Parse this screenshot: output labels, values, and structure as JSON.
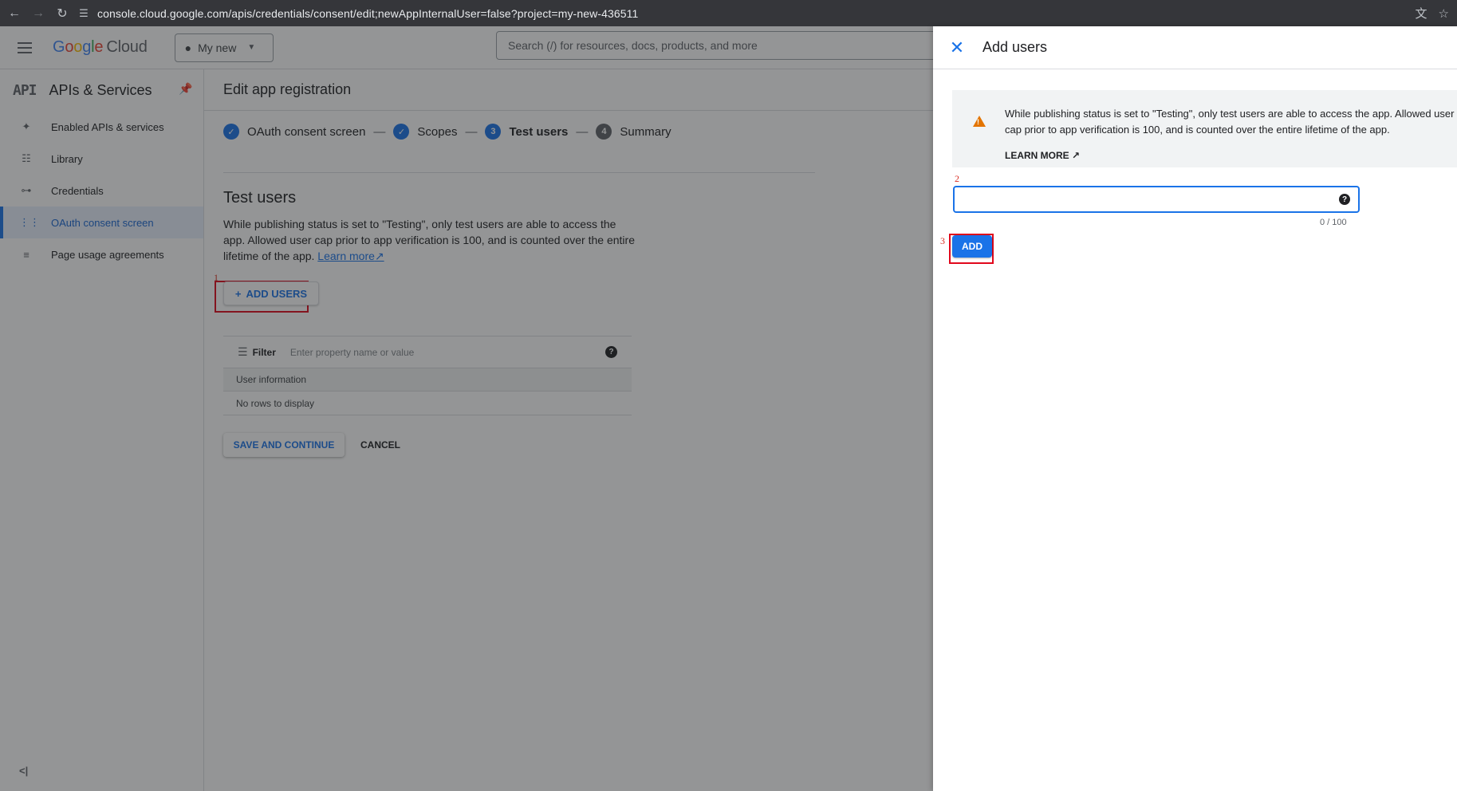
{
  "browser": {
    "url": "console.cloud.google.com/apis/credentials/consent/edit;newAppInternalUser=false?project=my-new-436511"
  },
  "topbar": {
    "logo_google": [
      "G",
      "o",
      "o",
      "g",
      "l",
      "e"
    ],
    "logo_cloud": "Cloud",
    "project_label": "My new",
    "search_placeholder": "Search (/) for resources, docs, products, and more"
  },
  "sidebar": {
    "api_badge": "API",
    "title": "APIs & Services",
    "items": [
      {
        "label": "Enabled APIs & services",
        "icon": "api-hub-icon"
      },
      {
        "label": "Library",
        "icon": "library-icon"
      },
      {
        "label": "Credentials",
        "icon": "key-icon"
      },
      {
        "label": "OAuth consent screen",
        "icon": "consent-icon",
        "active": true
      },
      {
        "label": "Page usage agreements",
        "icon": "settings-list-icon"
      }
    ],
    "collapse": "<|"
  },
  "main": {
    "page_title": "Edit app registration",
    "steps": [
      {
        "num": "✓",
        "label": "OAuth consent screen",
        "state": "done"
      },
      {
        "num": "✓",
        "label": "Scopes",
        "state": "done"
      },
      {
        "num": "3",
        "label": "Test users",
        "state": "current"
      },
      {
        "num": "4",
        "label": "Summary",
        "state": "todo"
      }
    ],
    "step_separator": "—",
    "section_title": "Test users",
    "section_desc": "While publishing status is set to \"Testing\", only test users are able to access the app. Allowed user cap prior to app verification is 100, and is counted over the entire lifetime of the app.",
    "learn_more": "Learn more",
    "add_users_label": "ADD USERS",
    "filter_label": "Filter",
    "filter_placeholder": "Enter property name or value",
    "table_header": "User information",
    "table_empty": "No rows to display",
    "save_continue": "SAVE AND CONTINUE",
    "cancel": "CANCEL"
  },
  "annotations": {
    "one": "1",
    "two": "2",
    "three": "3"
  },
  "panel": {
    "title": "Add users",
    "notice_text": "While publishing status is set to \"Testing\", only test users are able to access the app. Allowed user cap prior to app verification is 100, and is counted over the entire lifetime of the app.",
    "learn_more": "LEARN MORE",
    "email_value": "",
    "counter": "0 / 100",
    "add_label": "ADD"
  },
  "colors": {
    "accent": "#1a73e8",
    "warning": "#e37400",
    "annotation_red": "#e1081c"
  }
}
